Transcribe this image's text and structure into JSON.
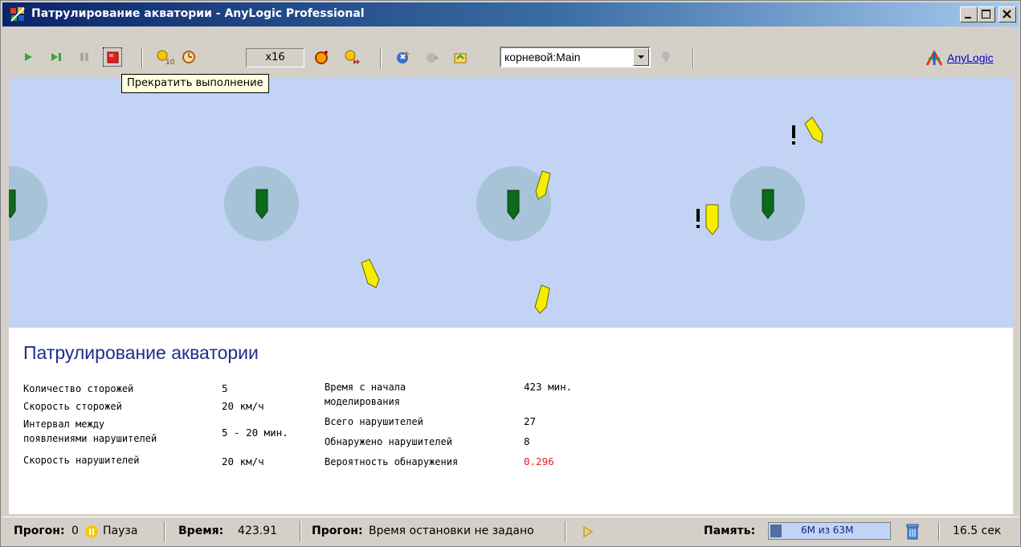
{
  "window": {
    "title": "Патрулирование акватории - AnyLogic Professional"
  },
  "toolbar": {
    "speed": "x16",
    "root_select": "корневой:Main",
    "tooltip": "Прекратить выполнение",
    "anylogic_link": "AnyLogic"
  },
  "panel": {
    "title": "Патрулирование акватории",
    "params": [
      {
        "label": "Количество сторожей",
        "value": "5"
      },
      {
        "label": "Скорость сторожей",
        "value": "20 км/ч"
      },
      {
        "label": "Интервал между\nпоявлениями нарушителей",
        "label_line1": "Интервал между",
        "label_line2": "появлениями нарушителей",
        "value": "5 - 20 мин."
      },
      {
        "label": "Скорость нарушителей",
        "value": "20 км/ч"
      }
    ],
    "stats": [
      {
        "label_line1": "Время с начала",
        "label_line2": "моделирования",
        "value": "423 мин."
      },
      {
        "label": "Всего нарушителей",
        "value": "27"
      },
      {
        "label": "Обнаружено нарушителей",
        "value": "8"
      },
      {
        "label": "Вероятность обнаружения",
        "value": "0.296",
        "color": "#e02020"
      }
    ]
  },
  "statusbar": {
    "run_label": "Прогон:",
    "run_value": "0",
    "pause": "Пауза",
    "time_label": "Время:",
    "time_value": "423.91",
    "run2_label": "Прогон:",
    "run2_value": "Время остановки не задано",
    "memory_label": "Память:",
    "memory_value": "6М из 63М",
    "memory_fraction": 0.095,
    "elapsed": "16.5 сек"
  },
  "colors": {
    "water": "#c3d3f5",
    "zone": "#a6c3d8",
    "guard_ship": "#0b6b1b",
    "intruder_ship": "#f5ee00",
    "panel_title": "#1c2f8a",
    "probability": "#e02020"
  },
  "icons": [
    "app-icon",
    "run-icon",
    "step-icon",
    "pause-icon",
    "stop-icon",
    "time-units-icon",
    "realtime-icon",
    "faster-icon",
    "slower-icon",
    "up-level-icon",
    "back-icon",
    "home-icon",
    "navigate-icon",
    "anylogic-logo-icon",
    "pause-status-icon",
    "play-status-icon",
    "trash-icon"
  ]
}
